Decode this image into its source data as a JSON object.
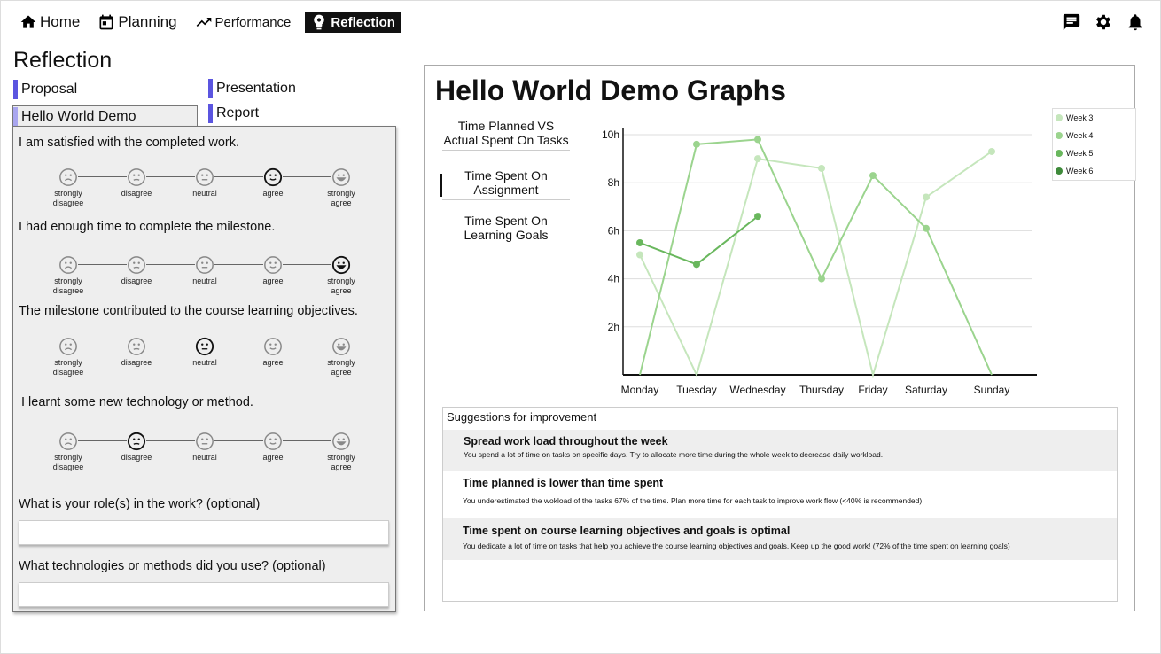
{
  "nav": {
    "home": "Home",
    "planning": "Planning",
    "performance": "Performance",
    "reflection": "Reflection"
  },
  "page_title": "Reflection",
  "milestones": {
    "proposal": "Proposal",
    "presentation": "Presentation",
    "hello_world_demo": "Hello World Demo",
    "report": "Report"
  },
  "form": {
    "q1": "I am satisfied with the completed work.",
    "q2": "I had enough time to complete the milestone.",
    "q3": "The milestone contributed to the course learning objectives.",
    "q4": "I learnt some new technology or method.",
    "q5": "What is your role(s) in the work? (optional)",
    "q6": "What technologies or methods did you use? (optional)",
    "scale_labels": [
      "strongly disagree",
      "disagree",
      "neutral",
      "agree",
      "strongly agree"
    ],
    "answers": [
      "agree",
      "strongly agree",
      "neutral",
      "disagree"
    ],
    "role_value": "",
    "tech_value": ""
  },
  "graphs": {
    "title": "Hello World Demo Graphs",
    "tabs": [
      "Time Planned VS Actual Spent On Tasks",
      "Time Spent On Assignment",
      "Time Spent On Learning Goals"
    ],
    "selected_tab": "Time Spent On Assignment"
  },
  "chart_data": {
    "type": "line",
    "x": [
      "Monday",
      "Tuesday",
      "Wednesday",
      "Thursday",
      "Friday",
      "Saturday",
      "Sunday"
    ],
    "ytick_labels": [
      "2h",
      "4h",
      "6h",
      "8h",
      "10h"
    ],
    "ylim": [
      0,
      10.5
    ],
    "grid": true,
    "legend_position": "top-right",
    "series": [
      {
        "name": "Week 3",
        "color": "#c5e6bc",
        "values": [
          5,
          0,
          9,
          8.6,
          0,
          7.4,
          9.3
        ]
      },
      {
        "name": "Week 4",
        "color": "#9bd48e",
        "values": [
          0,
          9.6,
          9.8,
          4,
          8.3,
          6.1,
          0
        ]
      },
      {
        "name": "Week 5",
        "color": "#69b75d",
        "values": [
          5.5,
          4.6,
          6.6,
          null,
          null,
          null,
          null
        ]
      },
      {
        "name": "Week 6",
        "color": "#3e8a3a",
        "values": [
          null,
          null,
          null,
          null,
          null,
          null,
          null
        ]
      }
    ]
  },
  "suggestions": {
    "header": "Suggestions for improvement",
    "items": [
      {
        "title": "Spread work load throughout the week",
        "desc": "You spend a lot of time on tasks on specific days. Try to allocate more time during the whole week to decrease daily workload."
      },
      {
        "title": "Time planned is lower than time spent",
        "desc": "You underestimated the wokload of the tasks 67% of the time. Plan more time for each task to improve work flow (<40% is recommended)"
      },
      {
        "title": "Time spent on course learning objectives and goals is optimal",
        "desc": "You dedicate a lot of time on tasks that help you achieve the course learning objectives and goals. Keep up the good work! (72% of the time spent on learning goals)"
      }
    ]
  }
}
